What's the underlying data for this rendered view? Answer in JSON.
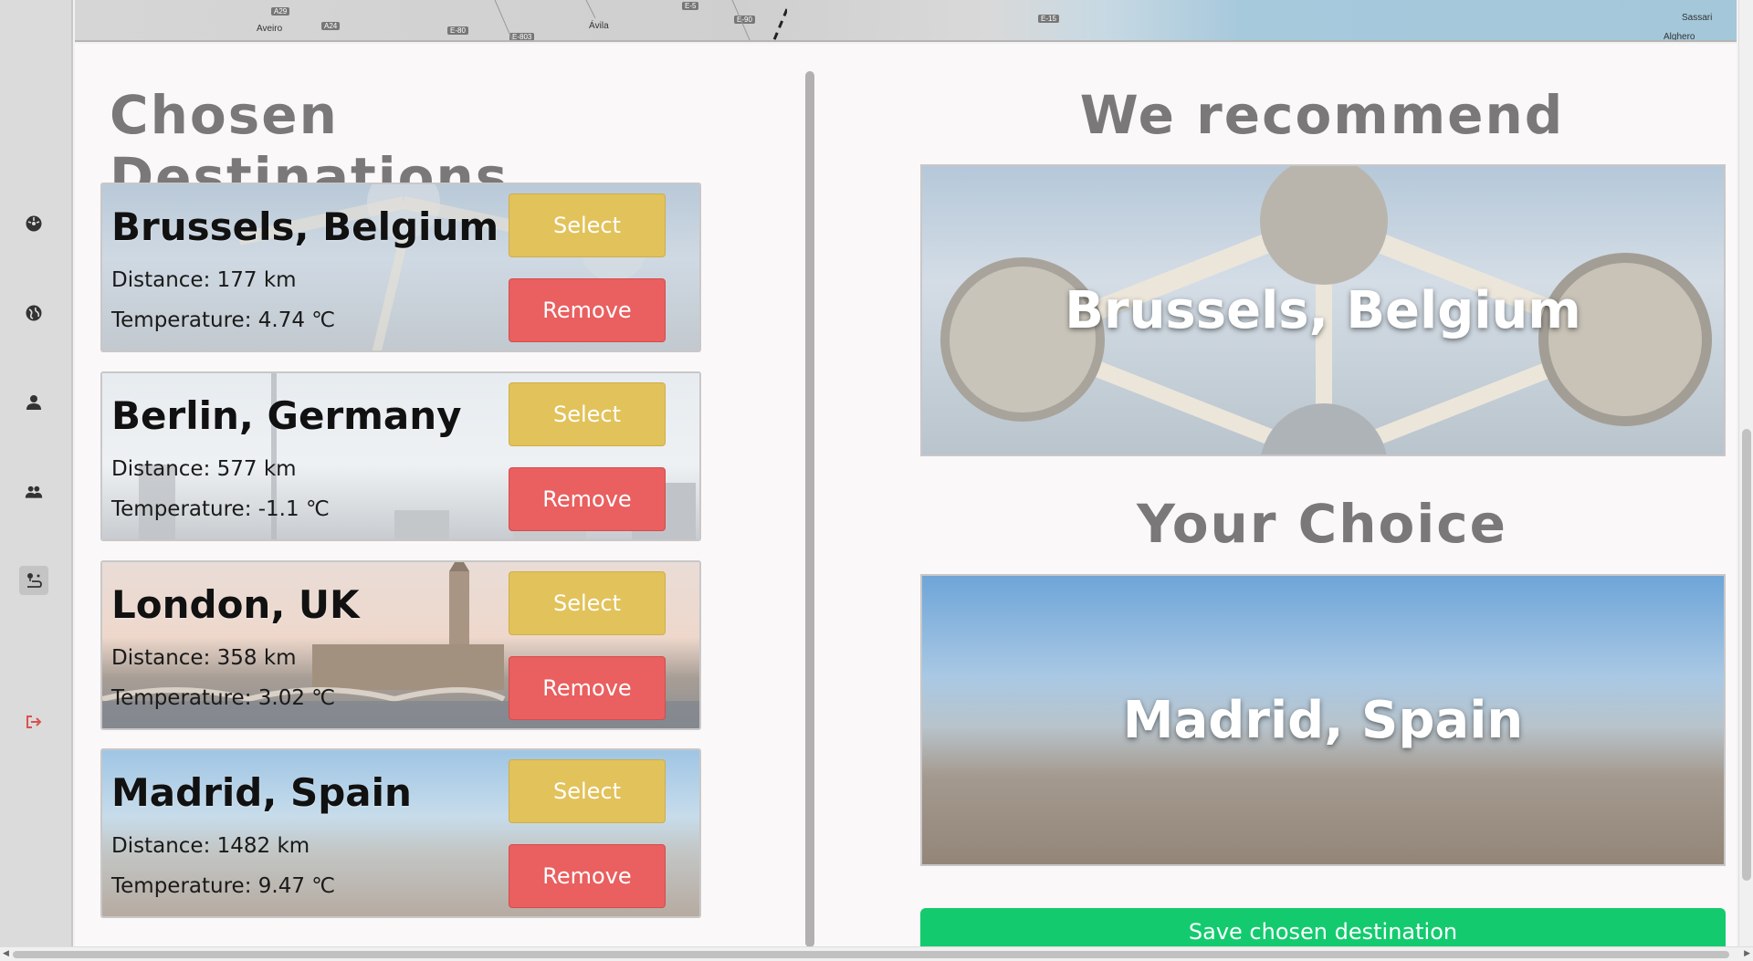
{
  "sidebar": {
    "items": [
      {
        "icon": "dashboard-icon",
        "name": "sidebar-item-dashboard"
      },
      {
        "icon": "globe-icon",
        "name": "sidebar-item-explore"
      },
      {
        "icon": "user-icon",
        "name": "sidebar-item-profile"
      },
      {
        "icon": "users-icon",
        "name": "sidebar-item-group"
      },
      {
        "icon": "route-icon",
        "name": "sidebar-item-destinations"
      },
      {
        "icon": "logout-icon",
        "name": "sidebar-item-logout"
      }
    ]
  },
  "map": {
    "labels": [
      "Aveiro",
      "Ávila",
      "Sassari",
      "Alghero"
    ],
    "shields": [
      "A29",
      "A24",
      "E-80",
      "E-803",
      "E-5",
      "E-90",
      "E-15"
    ]
  },
  "left": {
    "heading": "Chosen Destinations",
    "select_label": "Select",
    "remove_label": "Remove",
    "cards": [
      {
        "title": "Brussels, Belgium",
        "distance": "Distance: 177 km",
        "temperature": "Temperature: 4.74 ℃"
      },
      {
        "title": "Berlin, Germany",
        "distance": "Distance: 577 km",
        "temperature": "Temperature: -1.1 ℃"
      },
      {
        "title": "London, UK",
        "distance": "Distance: 358 km",
        "temperature": "Temperature: 3.02 ℃"
      },
      {
        "title": "Madrid, Spain",
        "distance": "Distance: 1482 km",
        "temperature": "Temperature: 9.47 ℃"
      }
    ]
  },
  "right": {
    "recommend_heading": "We recommend",
    "recommend_city": "Brussels, Belgium",
    "choice_heading": "Your Choice",
    "choice_city": "Madrid, Spain",
    "save_label": "Save chosen destination"
  },
  "colors": {
    "select": "#e2c25a",
    "remove": "#ea5f5f",
    "save": "#13cb6e",
    "logout": "#d9534f"
  }
}
